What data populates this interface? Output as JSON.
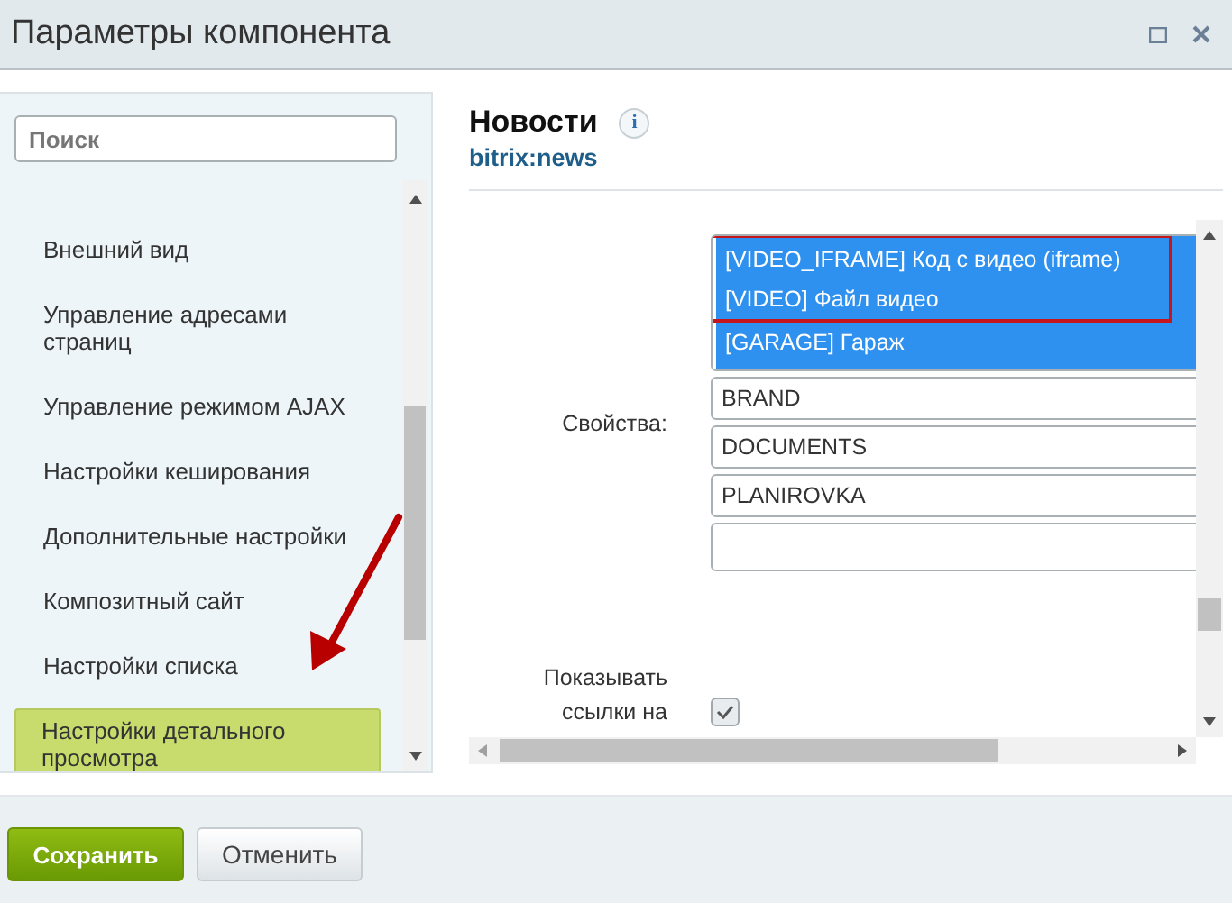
{
  "window": {
    "title": "Параметры компонента"
  },
  "sidebar": {
    "search": {
      "placeholder": "Поиск"
    },
    "items": [
      {
        "label": "Внешний вид",
        "selected": false
      },
      {
        "label": "Управление адресами страниц",
        "selected": false
      },
      {
        "label": "Управление режимом AJAX",
        "selected": false
      },
      {
        "label": "Настройки кеширования",
        "selected": false
      },
      {
        "label": "Дополнительные настройки",
        "selected": false
      },
      {
        "label": "Композитный сайт",
        "selected": false
      },
      {
        "label": "Настройки списка",
        "selected": false
      },
      {
        "label": "Настройки детального просмотра",
        "selected": true
      }
    ]
  },
  "component": {
    "title": "Новости",
    "info": "i",
    "code": "bitrix:news"
  },
  "properties": {
    "label": "Свойства:",
    "options": [
      {
        "text": "[VIDEO_IFRAME] Код с видео (iframe)",
        "selected": true,
        "highlighted": true
      },
      {
        "text": "[VIDEO] Файл видео",
        "selected": true,
        "highlighted": true
      },
      {
        "text": "[GARAGE] Гараж",
        "selected": true,
        "highlighted": false
      }
    ],
    "values": [
      "BRAND",
      "DOCUMENTS",
      "PLANIROVKA"
    ]
  },
  "show_links": {
    "label": "Показывать ссылки на",
    "checked": true
  },
  "buttons": [
    {
      "label": "Сохранить",
      "kind": "primary"
    },
    {
      "label": "Отменить",
      "kind": "secondary"
    }
  ]
}
